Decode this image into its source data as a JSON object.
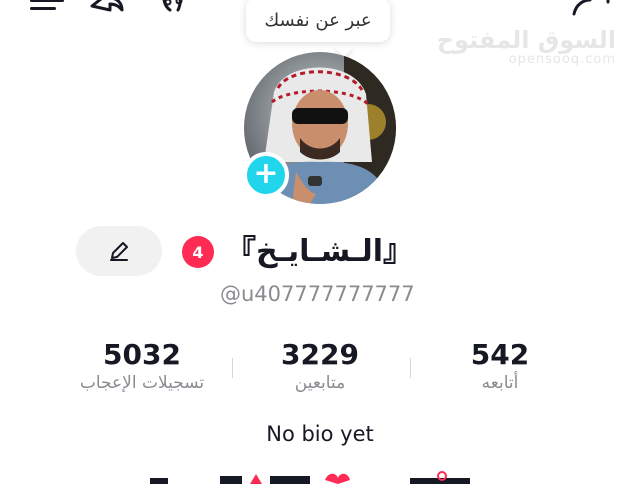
{
  "watermark": {
    "arabic": "السوق المفتوح",
    "latin": "opensooq.com"
  },
  "bio_bubble": {
    "text": "عبر عن نفسك"
  },
  "profile": {
    "display_name": "『الـشـايـخ』",
    "username": "@u407777777777",
    "notification_count": "4",
    "bio": "No bio yet"
  },
  "stats": {
    "likes": {
      "value": "5032",
      "label": "تسجيلات الإعجاب"
    },
    "followers": {
      "value": "3229",
      "label": "متابعين"
    },
    "following": {
      "value": "542",
      "label": "أتابعه"
    }
  },
  "colors": {
    "accent_cyan": "#20d5ec",
    "badge_red": "#fe2c55",
    "text_primary": "#161823",
    "text_secondary": "#8a8b91"
  }
}
